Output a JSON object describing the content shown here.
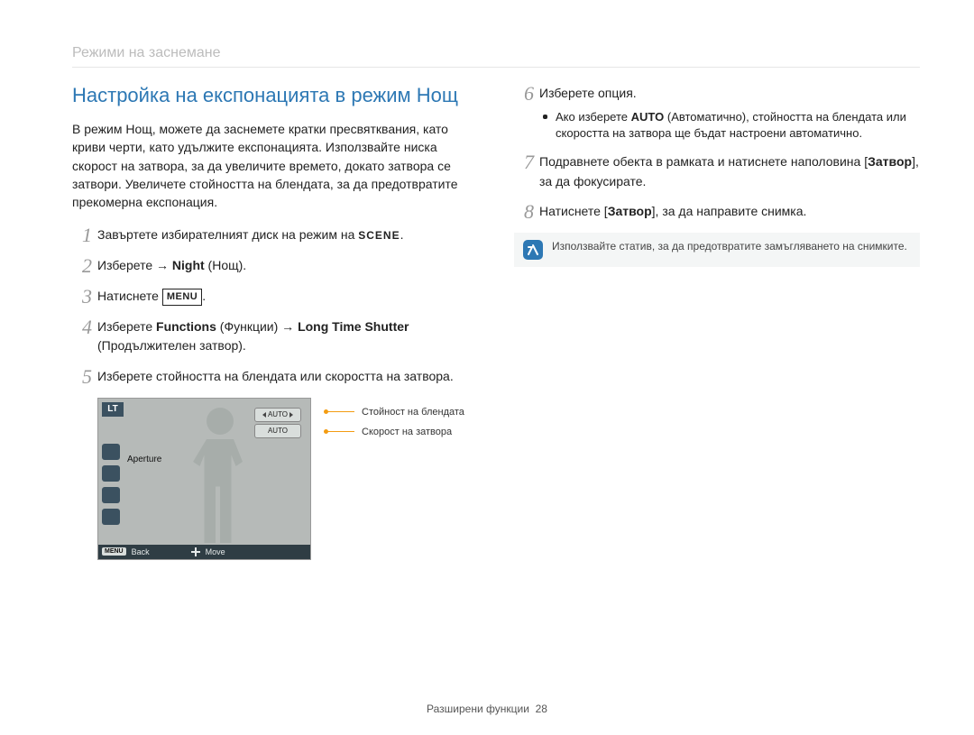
{
  "section_header": "Режими на заснемане",
  "title": "Настройка на експонацията в режим Нощ",
  "intro": "В режим Нощ, можете да заснемете кратки пресвятквания, като криви черти, като удължите експонацията. Използвайте ниска скорост на затвора, за да увеличите времето, докато затвора се затвори. Увеличете стойността на блендата, за да предотвратите прекомерна експонация.",
  "left_steps": {
    "s1": {
      "num": "1",
      "text_a": "Завъртете избирателният диск на режим на ",
      "scene": "SCENE",
      "text_b": "."
    },
    "s2": {
      "num": "2",
      "text_a": "Изберете → ",
      "bold1": "Night",
      "text_b": " (Нощ)."
    },
    "s3": {
      "num": "3",
      "text_a": "Натиснете ",
      "menu": "MENU",
      "text_b": "."
    },
    "s4": {
      "num": "4",
      "text_a": "Изберете ",
      "bold1": "Functions",
      "text_b": " (Функции) → ",
      "bold2": "Long Time Shutter",
      "text_c": " (Продължителен затвор)."
    },
    "s5": {
      "num": "5",
      "text_a": "Изберете стойността на блендата или скоростта на затвора."
    }
  },
  "right_steps": {
    "s6": {
      "num": "6",
      "text_a": "Изберете опция.",
      "bullet_a": "Ако изберете ",
      "bullet_bold": "AUTO",
      "bullet_b": " (Автоматично), стойността на блендата или скоростта на затвора ще бъдат настроени автоматично."
    },
    "s7": {
      "num": "7",
      "text_a": "Подравнете обекта в рамката и натиснете наполовина [",
      "bold1": "Затвор",
      "text_b": "], за да фокусирате."
    },
    "s8": {
      "num": "8",
      "text_a": "Натиснете [",
      "bold1": "Затвор",
      "text_b": "], за да направите снимка."
    }
  },
  "note": "Използвайте статив, за да предотвратите замъгляването на снимките.",
  "lcd": {
    "badge": "LT",
    "aperture_label": "Aperture",
    "pill1": "AUTO",
    "pill2": "AUTO",
    "back_menu": "MENU",
    "back_label": "Back",
    "move_label": "Move"
  },
  "callouts": {
    "c1": "Стойност на блендата",
    "c2": "Скорост на затвора"
  },
  "footer": {
    "label": "Разширени функции",
    "page": "28"
  }
}
